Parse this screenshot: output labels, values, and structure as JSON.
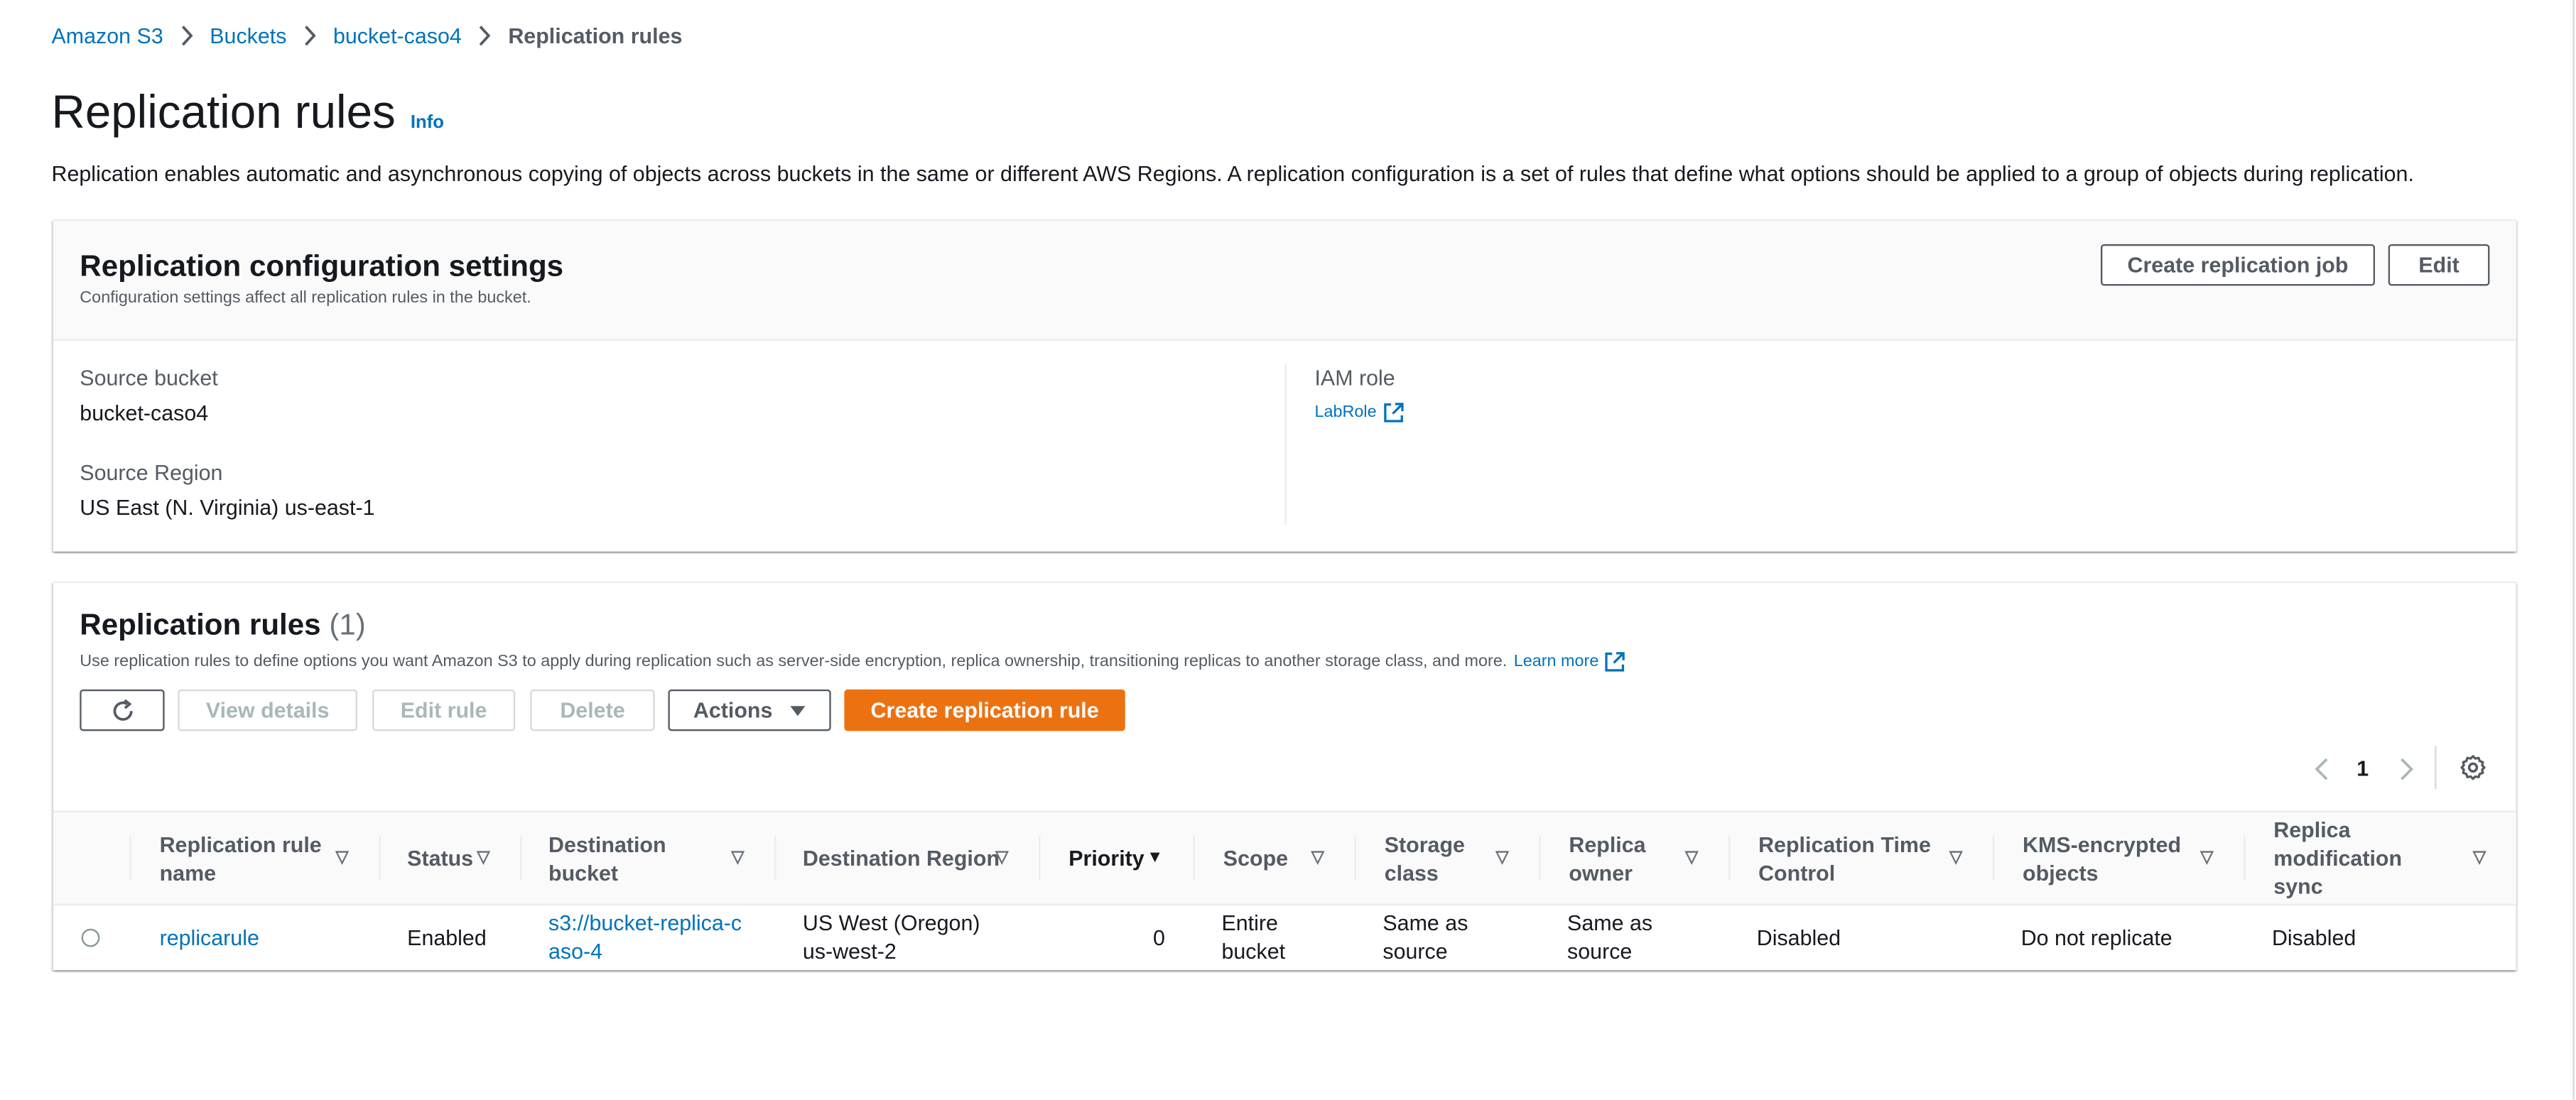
{
  "breadcrumb": [
    "Amazon S3",
    "Buckets",
    "bucket-caso4",
    "Replication rules"
  ],
  "page": {
    "title": "Replication rules",
    "info": "Info",
    "description": "Replication enables automatic and asynchronous copying of objects across buckets in the same or different AWS Regions. A replication configuration is a set of rules that define what options should be applied to a group of objects during replication."
  },
  "config": {
    "title": "Replication configuration settings",
    "subtitle": "Configuration settings affect all replication rules in the bucket.",
    "create_job_label": "Create replication job",
    "edit_label": "Edit",
    "source_bucket_label": "Source bucket",
    "source_bucket_value": "bucket-caso4",
    "source_region_label": "Source Region",
    "source_region_value": "US East (N. Virginia) us-east-1",
    "iam_role_label": "IAM role",
    "iam_role_value": "LabRole"
  },
  "rules": {
    "title": "Replication rules",
    "count": "(1)",
    "description": "Use replication rules to define options you want Amazon S3 to apply during replication such as server-side encryption, replica ownership, transitioning replicas to another storage class, and more.",
    "learn_more": "Learn more",
    "toolbar": {
      "view_details": "View details",
      "edit_rule": "Edit rule",
      "delete": "Delete",
      "actions": "Actions",
      "create_rule": "Create replication rule"
    },
    "pagination": {
      "page": "1"
    },
    "columns": [
      "Replication rule name",
      "Status",
      "Destination bucket",
      "Destination Region",
      "Priority",
      "Scope",
      "Storage class",
      "Replica owner",
      "Replication Time Control",
      "KMS-encrypted objects",
      "Replica modification sync"
    ],
    "rows": [
      {
        "name": "replicarule",
        "status": "Enabled",
        "destination_bucket": "s3://bucket-replica-caso-4",
        "destination_region": "US West (Oregon) us-west-2",
        "priority": "0",
        "scope": "Entire bucket",
        "storage_class": "Same as source",
        "replica_owner": "Same as source",
        "rtc": "Disabled",
        "kms": "Do not replicate",
        "modification_sync": "Disabled"
      }
    ]
  },
  "colors": {
    "link": "#0073bb",
    "primary": "#ec7211",
    "text": "#16191f",
    "muted": "#545b64"
  }
}
